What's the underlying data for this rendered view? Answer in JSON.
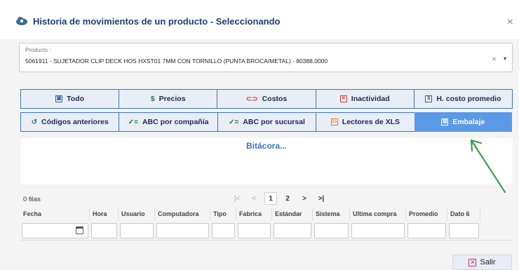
{
  "dialog": {
    "title": "Historia de movimientos de un producto - Seleccionando",
    "title_icon": "cloud-search-icon",
    "close_label": "×"
  },
  "product": {
    "label": "Producto :",
    "value": "5061911 - SUJETADOR CLIP DECK HOS HXST01 7MM CON TORNILLO (PUNTA BROCA/METAL) - 80388.0000",
    "clear": "×",
    "caret": "▾"
  },
  "tabs_row1": [
    {
      "label": "Todo",
      "icon": "grid-icon",
      "glyph": "▦"
    },
    {
      "label": "Precios",
      "icon": "dollar-icon",
      "glyph": "$"
    },
    {
      "label": "Costos",
      "icon": "money-icon",
      "glyph": "⊂⊃"
    },
    {
      "label": "Inactividad",
      "icon": "x-box-icon",
      "glyph": "✕"
    },
    {
      "label": "H. costo promedio",
      "icon": "document-dollar-icon",
      "glyph": "$"
    }
  ],
  "tabs_row2": [
    {
      "label": "Códigos anteriores",
      "icon": "history-icon",
      "glyph": "↺"
    },
    {
      "label": "ABC por compañía",
      "icon": "checklist-icon",
      "glyph": "✓="
    },
    {
      "label": "ABC por sucursal",
      "icon": "checklist-icon",
      "glyph": "✓="
    },
    {
      "label": "Lectores de XLS",
      "icon": "book-icon",
      "glyph": "▭"
    },
    {
      "label": "Embalaje",
      "icon": "package-icon",
      "glyph": "▤"
    }
  ],
  "bitacora": {
    "title": "Bitácora..."
  },
  "grid": {
    "rows_count": "0 filas",
    "pager": [
      "|<",
      "<",
      "1",
      "2",
      ">",
      ">|"
    ],
    "columns": [
      "Fecha",
      "Hora",
      "Usuario",
      "Computadora",
      "Tipo",
      "Fabrica",
      "Estándar",
      "Sistema",
      "Ultima compra",
      "Promedio",
      "Dato 6"
    ]
  },
  "footer": {
    "exit_label": "Salir"
  },
  "colors": {
    "tab_blue": "#3b74c0",
    "tab_active": "#5b9ae6",
    "title": "#1f3d7a",
    "annotation_arrow": "#3aa04a"
  }
}
